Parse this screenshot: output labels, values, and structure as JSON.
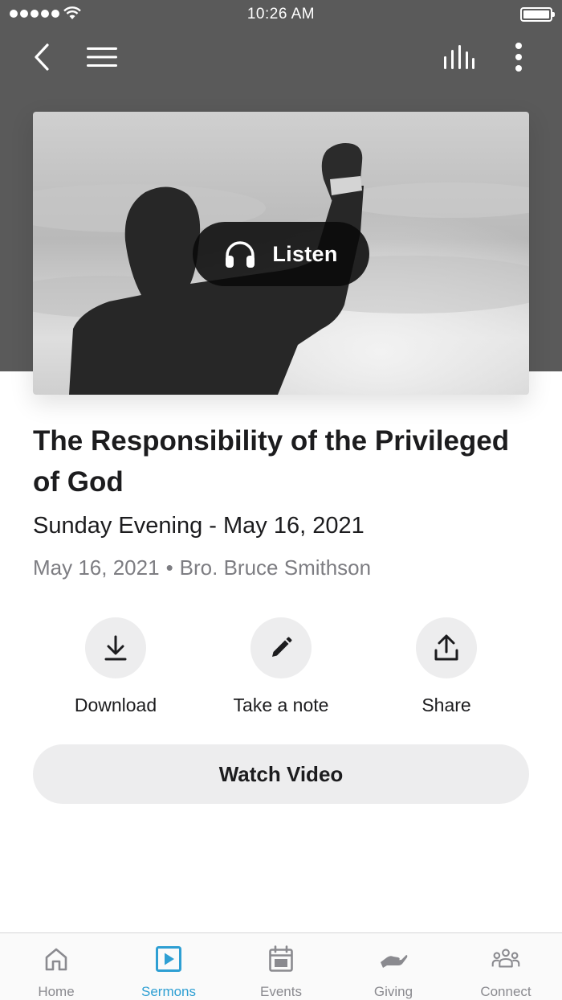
{
  "status_bar": {
    "time": "10:26 AM"
  },
  "colors": {
    "header_bg": "#5a5a5a",
    "accent": "#2e9fd3",
    "inactive": "#8a8a8f",
    "button_bg": "#ededee"
  },
  "header": {
    "back_icon": "chevron-left-icon",
    "menu_icon": "hamburger-icon",
    "audio_icon": "equalizer-icon",
    "more_icon": "more-vertical-icon"
  },
  "hero": {
    "listen_label": "Listen",
    "listen_icon": "headphones-icon"
  },
  "sermon": {
    "title": "The Responsibility of the Privileged of God",
    "subtitle": "Sunday Evening - May 16, 2021",
    "date": "May 16, 2021",
    "separator": "•",
    "speaker": "Bro. Bruce Smithson"
  },
  "actions": [
    {
      "label": "Download",
      "icon": "download-icon"
    },
    {
      "label": "Take a note",
      "icon": "pencil-icon"
    },
    {
      "label": "Share",
      "icon": "share-icon"
    }
  ],
  "watch_video_label": "Watch Video",
  "tabs": [
    {
      "label": "Home",
      "icon": "home-icon",
      "active": false
    },
    {
      "label": "Sermons",
      "icon": "play-square-icon",
      "active": true
    },
    {
      "label": "Events",
      "icon": "calendar-icon",
      "active": false
    },
    {
      "label": "Giving",
      "icon": "hand-icon",
      "active": false
    },
    {
      "label": "Connect",
      "icon": "people-icon",
      "active": false
    }
  ]
}
